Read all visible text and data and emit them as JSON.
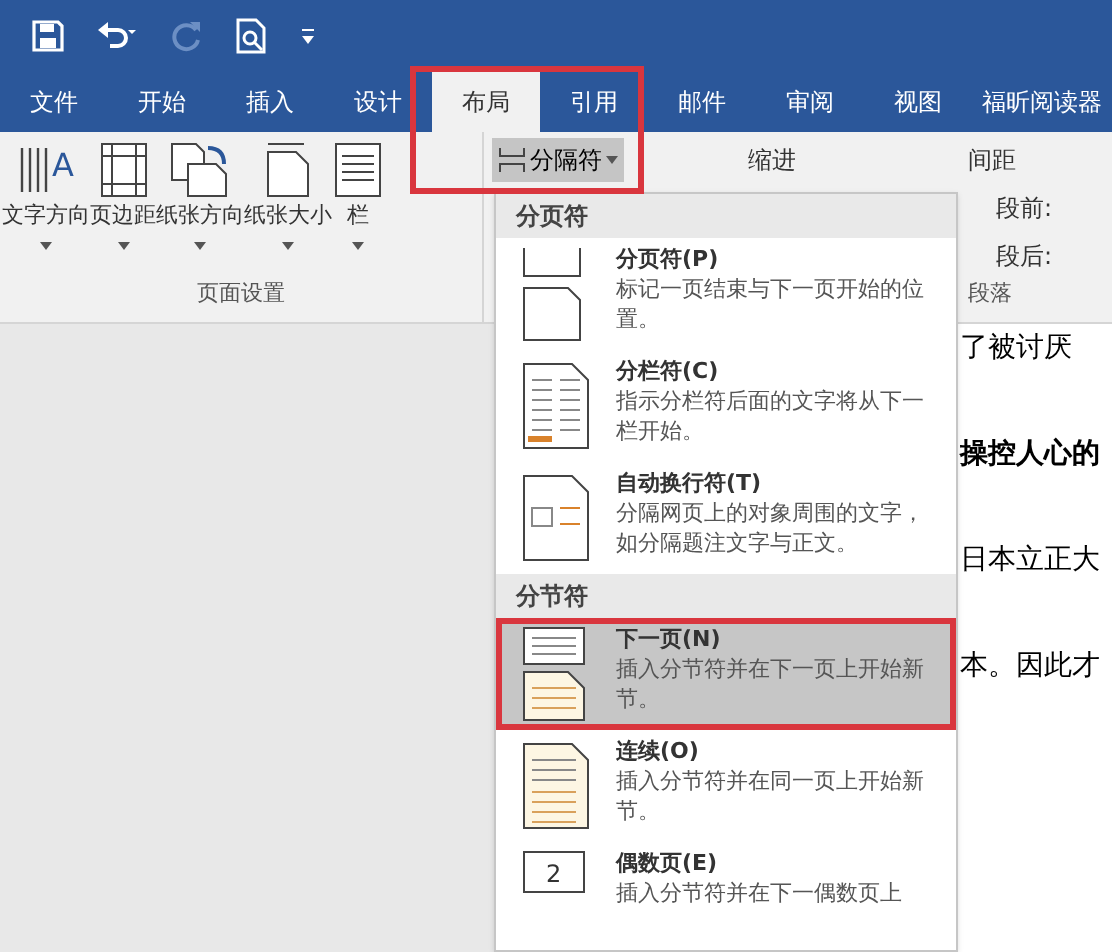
{
  "quick_access": {
    "undo_enabled": true,
    "redo_enabled": false
  },
  "tabs": [
    {
      "label": "文件",
      "selected": false
    },
    {
      "label": "开始",
      "selected": false
    },
    {
      "label": "插入",
      "selected": false
    },
    {
      "label": "设计",
      "selected": false
    },
    {
      "label": "布局",
      "selected": true
    },
    {
      "label": "引用",
      "selected": false
    },
    {
      "label": "邮件",
      "selected": false
    },
    {
      "label": "审阅",
      "selected": false
    },
    {
      "label": "视图",
      "selected": false
    },
    {
      "label": "福昕阅读器",
      "selected": false
    }
  ],
  "ribbon": {
    "page_setup": {
      "buttons": [
        {
          "label": "文字方向",
          "kind": "textdir",
          "icon_text": "A"
        },
        {
          "label": "页边距",
          "kind": "margins"
        },
        {
          "label": "纸张方向",
          "kind": "orientation"
        },
        {
          "label": "纸张大小",
          "kind": "size"
        },
        {
          "label": "栏",
          "kind": "columns"
        }
      ],
      "group_label": "页面设置"
    },
    "breaks_button": {
      "label": "分隔符",
      "pressed": true
    },
    "indent_label": "缩进",
    "spacing_label": "间距",
    "before_label": "段前:",
    "after_label": "段后:",
    "paragraph_label": "段落"
  },
  "document_lines": [
    {
      "text": "了被讨厌",
      "bold": false
    },
    {
      "text": "操控人心的",
      "bold": true
    },
    {
      "text": "日本立正大",
      "bold": false
    },
    {
      "text": "本。因此才",
      "bold": false
    }
  ],
  "menu": {
    "sections": [
      {
        "header": "分页符",
        "items": [
          {
            "title": "分页符(P)",
            "description": "标记一页结束与下一页开始的位置。",
            "kind": "page",
            "selected": false
          },
          {
            "title": "分栏符(C)",
            "description": "指示分栏符后面的文字将从下一栏开始。",
            "kind": "column",
            "selected": false
          },
          {
            "title": "自动换行符(T)",
            "description": "分隔网页上的对象周围的文字，如分隔题注文字与正文。",
            "kind": "wrap",
            "selected": false
          }
        ]
      },
      {
        "header": "分节符",
        "items": [
          {
            "title": "下一页(N)",
            "description": "插入分节符并在下一页上开始新节。",
            "kind": "nextpage",
            "selected": true
          },
          {
            "title": "连续(O)",
            "description": "插入分节符并在同一页上开始新节。",
            "kind": "continuous",
            "selected": false
          },
          {
            "title": "偶数页(E)",
            "description": "插入分节符并在下一偶数页上",
            "kind": "even",
            "icon_text": "2",
            "selected": false
          }
        ]
      }
    ]
  }
}
